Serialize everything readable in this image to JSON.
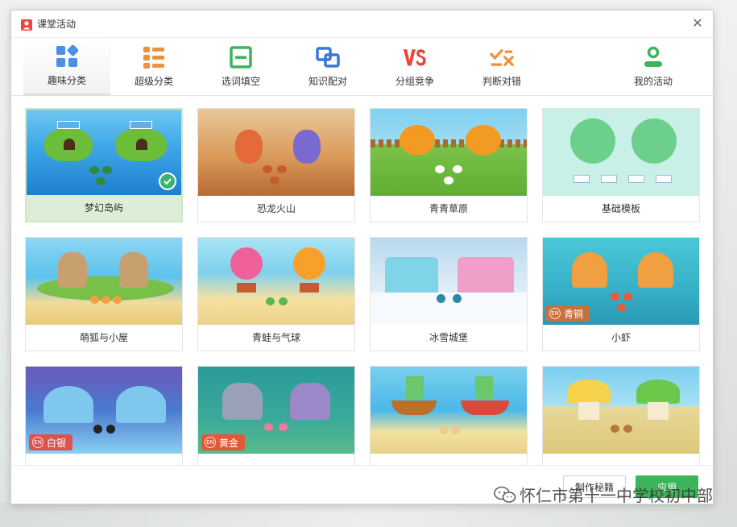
{
  "window": {
    "title": "课堂活动"
  },
  "tabs": [
    {
      "label": "趣味分类",
      "icon": "grid-blocks-icon",
      "color": "#4a8fe8"
    },
    {
      "label": "超级分类",
      "icon": "list-icon",
      "color": "#f0913a"
    },
    {
      "label": "选词填空",
      "icon": "fill-blank-icon",
      "color": "#3cb55a"
    },
    {
      "label": "知识配对",
      "icon": "link-icon",
      "color": "#3a78d8"
    },
    {
      "label": "分组竞争",
      "icon": "vs-icon",
      "color": "#e8473a"
    },
    {
      "label": "判断对错",
      "icon": "check-cross-icon",
      "color": "#f0913a"
    },
    {
      "label": "我的活动",
      "icon": "user-icon",
      "color": "#3cb55a"
    }
  ],
  "templates": [
    {
      "name": "梦幻岛屿",
      "selected": true,
      "badge": ""
    },
    {
      "name": "恐龙火山",
      "selected": false,
      "badge": ""
    },
    {
      "name": "青青草原",
      "selected": false,
      "badge": ""
    },
    {
      "name": "基础模板",
      "selected": false,
      "badge": ""
    },
    {
      "name": "萌狐与小屋",
      "selected": false,
      "badge": ""
    },
    {
      "name": "青蛙与气球",
      "selected": false,
      "badge": ""
    },
    {
      "name": "冰雪城堡",
      "selected": false,
      "badge": ""
    },
    {
      "name": "小虾",
      "selected": false,
      "badge": "青铜"
    },
    {
      "name": "",
      "selected": false,
      "badge": "白银"
    },
    {
      "name": "",
      "selected": false,
      "badge": "黄金"
    },
    {
      "name": "",
      "selected": false,
      "badge": ""
    },
    {
      "name": "",
      "selected": false,
      "badge": ""
    }
  ],
  "badges": {
    "bronze_icon_text": "EN",
    "silver_icon_text": "EN",
    "gold_icon_text": "EN"
  },
  "footer": {
    "secret_label": "制作秘籍",
    "apply_label": "应用"
  },
  "watermark": {
    "text": "怀仁市第十一中学校初中部"
  },
  "colors": {
    "accent": "#3cb55a",
    "selected_bg": "#dcefd6",
    "bronze": "#c8703c",
    "silver": "#d9534f",
    "gold": "#e05a3a"
  }
}
